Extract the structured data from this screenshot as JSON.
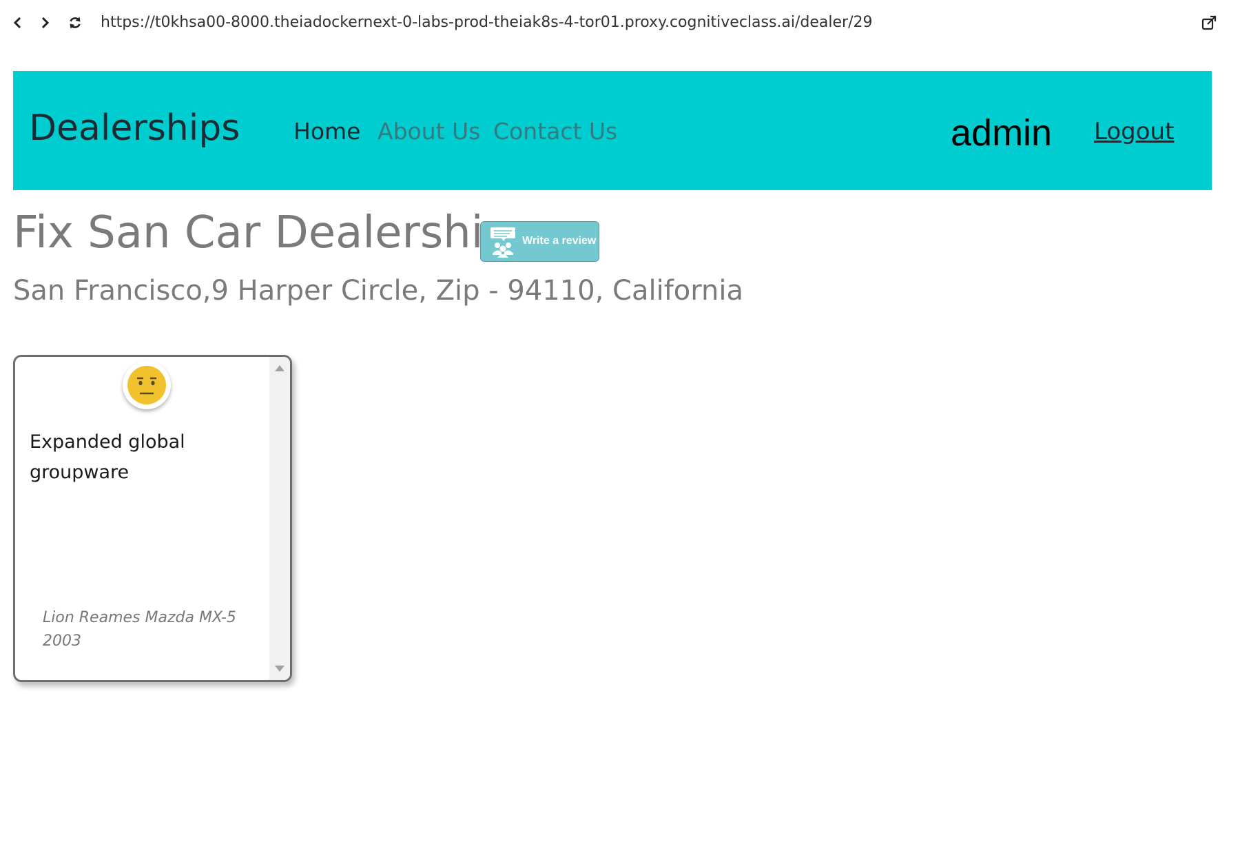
{
  "browser": {
    "url": "https://t0khsa00-8000.theiadockernext-0-labs-prod-theiak8s-4-tor01.proxy.cognitiveclass.ai/dealer/29",
    "back_icon": "chevron-left-icon",
    "forward_icon": "chevron-right-icon",
    "reload_icon": "reload-icon",
    "open_external_icon": "open-external-icon"
  },
  "header": {
    "brand": "Dealerships",
    "nav": {
      "home": "Home",
      "about": "About Us",
      "contact": "Contact Us"
    },
    "username": "admin",
    "logout": "Logout",
    "background_color": "#00cdd0"
  },
  "dealer": {
    "name": "Fix San Car Dealership",
    "address": "San Francisco,9 Harper Circle, Zip - 94110, California",
    "review_button_label": "Write a review",
    "review_button_icon": "people-chat-icon"
  },
  "reviews": [
    {
      "sentiment": "neutral",
      "sentiment_icon": "neutral-face-icon",
      "text": "Expanded global groupware",
      "reviewer_line": "Lion Reames Mazda MX-5 2003"
    }
  ]
}
